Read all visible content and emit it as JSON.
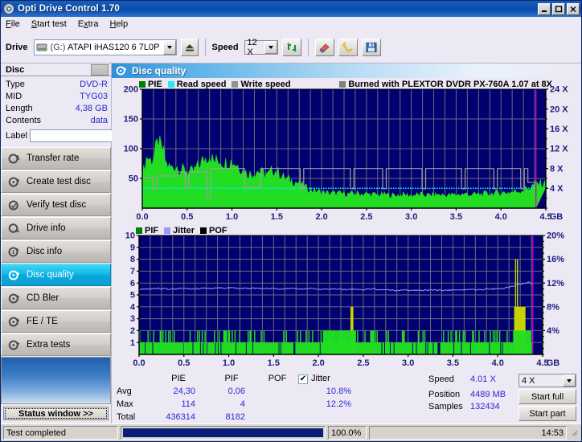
{
  "window": {
    "title": "Opti Drive Control 1.70",
    "icon": "disc-icon",
    "minimize": "_",
    "maximize": "□",
    "close": "✕"
  },
  "menu": [
    "File",
    "Start test",
    "Extra",
    "Help"
  ],
  "toolbar": {
    "drive_label": "Drive",
    "drive_icon": "drive-icon",
    "drive_value_id": "(G:)",
    "drive_value_name": "ATAPI iHAS120  6 7L0P",
    "eject_icon": "eject-icon",
    "speed_label": "Speed",
    "speed_value": "12 X",
    "refresh_icon": "refresh-icon",
    "erase_icon": "eraser-icon",
    "key_icon": "key-icon",
    "save_icon": "save-floppy-icon"
  },
  "sidebar": {
    "disc_header": "Disc",
    "info": [
      {
        "key": "Type",
        "value": "DVD-R"
      },
      {
        "key": "MID",
        "value": "TYG03"
      },
      {
        "key": "Length",
        "value": "4,38 GB"
      },
      {
        "key": "Contents",
        "value": "data"
      }
    ],
    "label_key": "Label",
    "label_value": "",
    "label_placeholder": "",
    "items": [
      {
        "label": "Transfer rate",
        "icon": "disc-test-icon"
      },
      {
        "label": "Create test disc",
        "icon": "disc-burn-icon"
      },
      {
        "label": "Verify test disc",
        "icon": "disc-verify-icon"
      },
      {
        "label": "Drive info",
        "icon": "disc-drive-icon"
      },
      {
        "label": "Disc info",
        "icon": "disc-info-icon"
      },
      {
        "label": "Disc quality",
        "icon": "disc-quality-icon"
      },
      {
        "label": "CD Bler",
        "icon": "disc-bler-icon"
      },
      {
        "label": "FE / TE",
        "icon": "disc-fete-icon"
      },
      {
        "label": "Extra tests",
        "icon": "disc-extra-icon"
      }
    ],
    "active_item": "Disc quality",
    "status_window_button": "Status window  >>"
  },
  "panel": {
    "title": "Disc quality",
    "icon": "disc-quality-icon"
  },
  "stats": {
    "columns": [
      "",
      "PIE",
      "PIF",
      "POF",
      "Jitter"
    ],
    "jitter_checkbox_label": "Jitter",
    "jitter_checked": true,
    "jitter_check_glyph": "✔",
    "rows": [
      {
        "label": "Avg",
        "pie": "24,30",
        "pif": "0,06",
        "pof": "",
        "jitter": "10.8%"
      },
      {
        "label": "Max",
        "pie": "114",
        "pif": "4",
        "pof": "",
        "jitter": "12.2%"
      },
      {
        "label": "Total",
        "pie": "436314",
        "pif": "8182",
        "pof": "",
        "jitter": ""
      }
    ],
    "right": [
      {
        "key": "Speed",
        "value": "4.01 X"
      },
      {
        "key": "Position",
        "value": "4489 MB"
      },
      {
        "key": "Samples",
        "value": "132434"
      }
    ],
    "speed_select": "4 X",
    "start_full": "Start full",
    "start_part": "Start part"
  },
  "statusbar": {
    "message": "Test completed",
    "progress_pct": "100.0%",
    "progress_value": 100,
    "time": "14:53",
    "grip_icon": "resize-grip-icon"
  },
  "colors": {
    "pie": "#00a000",
    "pie_fill": "#22dd22",
    "pif": "#22dd22",
    "read_speed": "#00f0ff",
    "write_speed": "#a0a0a0",
    "jitter": "#8e8ef0",
    "pof": "#000000",
    "plot_bg": "#000070",
    "grid": "#808080",
    "marker": "#d000d0",
    "accent": "#0a4fb0",
    "value_text": "#2a2ad0"
  },
  "chart_data": [
    {
      "type": "area",
      "name": "pie-chart",
      "title": "",
      "legend": [
        "PIE",
        "Read speed",
        "Write speed"
      ],
      "legend_right": "Burned with PLEXTOR DVDR  PX-760A 1.07 at 8X",
      "xlabel": "GB",
      "xlim": [
        0.0,
        4.5
      ],
      "xticks": [
        "0.0",
        "0.5",
        "1.0",
        "1.5",
        "2.0",
        "2.5",
        "3.0",
        "3.5",
        "4.0",
        "4.5"
      ],
      "ylabel_left": "PIE",
      "ylim_left": [
        0,
        200
      ],
      "yticks_left": [
        "200",
        "150",
        "100",
        "50"
      ],
      "ylabel_right": "speed",
      "ylim_right": [
        0,
        24
      ],
      "yticks_right": [
        "24 X",
        "20 X",
        "16 X",
        "12 X",
        "8 X",
        "4 X"
      ],
      "grid": true,
      "marker_x": 4.39,
      "series": [
        {
          "name": "PIE",
          "color": "#22dd22",
          "kind": "area",
          "x": [
            0.0,
            0.05,
            0.1,
            0.14,
            0.18,
            0.2,
            0.23,
            0.27,
            0.32,
            0.38,
            0.43,
            0.48,
            0.53,
            0.58,
            0.64,
            0.7,
            0.75,
            0.8,
            0.86,
            0.92,
            0.98,
            1.04,
            1.1,
            1.16,
            1.22,
            1.28,
            1.34,
            1.4,
            1.46,
            1.52,
            1.58,
            1.64,
            1.7,
            1.76,
            1.82,
            1.88,
            1.94,
            2.0,
            2.1,
            2.2,
            2.3,
            2.4,
            2.5,
            2.6,
            2.7,
            2.8,
            2.9,
            3.0,
            3.1,
            3.2,
            3.3,
            3.4,
            3.5,
            3.6,
            3.7,
            3.8,
            3.9,
            4.0,
            4.1,
            4.2,
            4.3,
            4.39
          ],
          "y": [
            52,
            86,
            78,
            90,
            112,
            100,
            96,
            72,
            66,
            70,
            62,
            64,
            58,
            62,
            72,
            82,
            88,
            76,
            80,
            74,
            78,
            74,
            66,
            58,
            56,
            62,
            58,
            54,
            64,
            58,
            50,
            46,
            44,
            40,
            34,
            30,
            28,
            26,
            24,
            24,
            23,
            24,
            23,
            22,
            22,
            21,
            22,
            21,
            22,
            21,
            22,
            21,
            22,
            23,
            22,
            23,
            24,
            25,
            26,
            28,
            32,
            40
          ]
        },
        {
          "name": "Read speed",
          "color": "#00f0ff",
          "kind": "line-dashed",
          "x": [
            0.0,
            0.5,
            1.0,
            1.5,
            2.0,
            2.5,
            3.0,
            3.5,
            4.0,
            4.39
          ],
          "y": [
            4.0,
            4.0,
            4.0,
            4.0,
            4.0,
            4.0,
            4.0,
            4.0,
            4.0,
            4.0
          ]
        },
        {
          "name": "Write speed",
          "color": "#a0a0a0",
          "kind": "step",
          "x": [
            0.0,
            0.08,
            0.12,
            0.16,
            0.4,
            0.44,
            0.48,
            0.52,
            0.68,
            0.72,
            0.76,
            1.1,
            1.14,
            1.32,
            1.36,
            1.4,
            1.72,
            1.76,
            1.8,
            2.28,
            2.32,
            2.36,
            2.64,
            2.68,
            2.72,
            3.08,
            3.12,
            3.16,
            3.52,
            3.56,
            3.6,
            3.88,
            3.92,
            3.96,
            4.18,
            4.22,
            4.26,
            4.3,
            4.39
          ],
          "y": [
            6.2,
            6.2,
            3.9,
            6.5,
            7.3,
            7.3,
            4.0,
            7.3,
            7.4,
            2.0,
            8.0,
            8.0,
            4.2,
            8.0,
            8.0,
            8.0,
            8.0,
            3.9,
            8.0,
            8.0,
            3.9,
            8.0,
            8.0,
            3.9,
            8.0,
            8.0,
            3.9,
            8.0,
            8.0,
            3.9,
            8.0,
            8.0,
            3.9,
            8.0,
            8.0,
            3.9,
            8.0,
            5.2,
            5.2
          ]
        }
      ]
    },
    {
      "type": "bar",
      "name": "pif-chart",
      "title": "",
      "legend": [
        "PIF",
        "Jitter",
        "POF"
      ],
      "xlabel": "GB",
      "xlim": [
        0.0,
        4.5
      ],
      "xticks": [
        "0.0",
        "0.5",
        "1.0",
        "1.5",
        "2.0",
        "2.5",
        "3.0",
        "3.5",
        "4.0",
        "4.5"
      ],
      "ylabel_left": "PIF",
      "ylim_left": [
        0,
        10
      ],
      "yticks_left": [
        "10",
        "9",
        "8",
        "7",
        "6",
        "5",
        "4",
        "3",
        "2",
        "1"
      ],
      "ylabel_right": "Jitter",
      "ylim_right": [
        0,
        20
      ],
      "yticks_right": [
        "20%",
        "16%",
        "12%",
        "8%",
        "4%"
      ],
      "grid": true,
      "marker_x": 4.39,
      "series": [
        {
          "name": "PIF",
          "color": "#22dd22",
          "kind": "bars",
          "x": [
            0.02,
            0.05,
            0.08,
            0.11,
            0.14,
            0.17,
            0.2,
            0.23,
            0.25,
            0.27,
            0.29,
            0.32,
            0.34,
            0.37,
            0.4,
            0.43,
            0.46,
            0.49,
            0.52,
            0.55,
            0.58,
            0.61,
            0.64,
            0.67,
            0.7,
            0.73,
            0.76,
            0.79,
            0.82,
            0.85,
            0.88,
            0.91,
            0.94,
            0.97,
            1.0,
            1.03,
            1.06,
            1.09,
            1.12,
            1.15,
            1.18,
            1.21,
            1.24,
            1.27,
            1.3,
            1.34,
            1.38,
            1.42,
            1.46,
            1.5,
            1.54,
            1.58,
            1.62,
            1.66,
            1.7,
            1.74,
            1.78,
            1.82,
            1.86,
            1.9,
            1.94,
            1.98,
            2.02,
            2.06,
            2.12,
            2.18,
            2.24,
            2.3,
            2.36,
            2.42,
            2.48,
            2.54,
            2.6,
            2.66,
            2.72,
            2.78,
            2.84,
            2.9,
            2.96,
            3.02,
            3.08,
            3.14,
            3.2,
            3.26,
            3.32,
            3.38,
            3.44,
            3.5,
            3.56,
            3.62,
            3.68,
            3.74,
            3.8,
            3.86,
            3.92,
            3.98,
            4.04,
            4.1,
            4.16,
            4.2,
            4.24,
            4.26,
            4.28,
            4.32,
            4.36,
            4.39
          ],
          "y": [
            1,
            1,
            1,
            1,
            1,
            1,
            1,
            2,
            1,
            2,
            1,
            1,
            2,
            1,
            1,
            1,
            1,
            1,
            1,
            1,
            1,
            1,
            2,
            1,
            1,
            2,
            1,
            1,
            2,
            1,
            1,
            1,
            2,
            1,
            2,
            1,
            1,
            1,
            2,
            1,
            1,
            2,
            1,
            1,
            1,
            1,
            2,
            1,
            1,
            1,
            1,
            1,
            2,
            1,
            1,
            1,
            2,
            1,
            2,
            1,
            1,
            1,
            1,
            2,
            2,
            2,
            2,
            2,
            4,
            2,
            3,
            2,
            2,
            1,
            1,
            1,
            1,
            1,
            2,
            1,
            1,
            2,
            1,
            1,
            1,
            2,
            1,
            1,
            1,
            2,
            1,
            1,
            1,
            2,
            1,
            1,
            1,
            2,
            2,
            8,
            8,
            8,
            4,
            2,
            2,
            2
          ]
        },
        {
          "name": "Jitter",
          "color": "#8e8ef0",
          "kind": "line",
          "x": [
            0.0,
            0.1,
            0.2,
            0.3,
            0.4,
            0.5,
            0.6,
            0.7,
            0.8,
            0.9,
            1.0,
            1.1,
            1.2,
            1.3,
            1.4,
            1.5,
            1.6,
            1.7,
            1.8,
            1.9,
            2.0,
            2.1,
            2.2,
            2.3,
            2.4,
            2.5,
            2.6,
            2.7,
            2.8,
            2.9,
            3.0,
            3.1,
            3.2,
            3.3,
            3.4,
            3.5,
            3.6,
            3.7,
            3.8,
            3.9,
            4.0,
            4.05,
            4.1,
            4.15,
            4.2,
            4.25,
            4.3,
            4.34,
            4.39
          ],
          "y": [
            10.9,
            11.0,
            11.1,
            11.0,
            11.0,
            11.1,
            11.0,
            11.1,
            11.1,
            11.2,
            11.2,
            11.1,
            11.1,
            11.1,
            11.1,
            11.1,
            11.0,
            11.1,
            11.0,
            11.1,
            11.0,
            11.0,
            11.0,
            10.9,
            11.0,
            10.9,
            11.0,
            10.9,
            10.8,
            10.8,
            10.8,
            10.8,
            10.8,
            10.8,
            10.8,
            10.8,
            10.9,
            10.9,
            10.9,
            11.0,
            11.0,
            11.1,
            11.2,
            11.4,
            11.6,
            11.8,
            11.9,
            12.1,
            11.9
          ]
        }
      ]
    }
  ]
}
